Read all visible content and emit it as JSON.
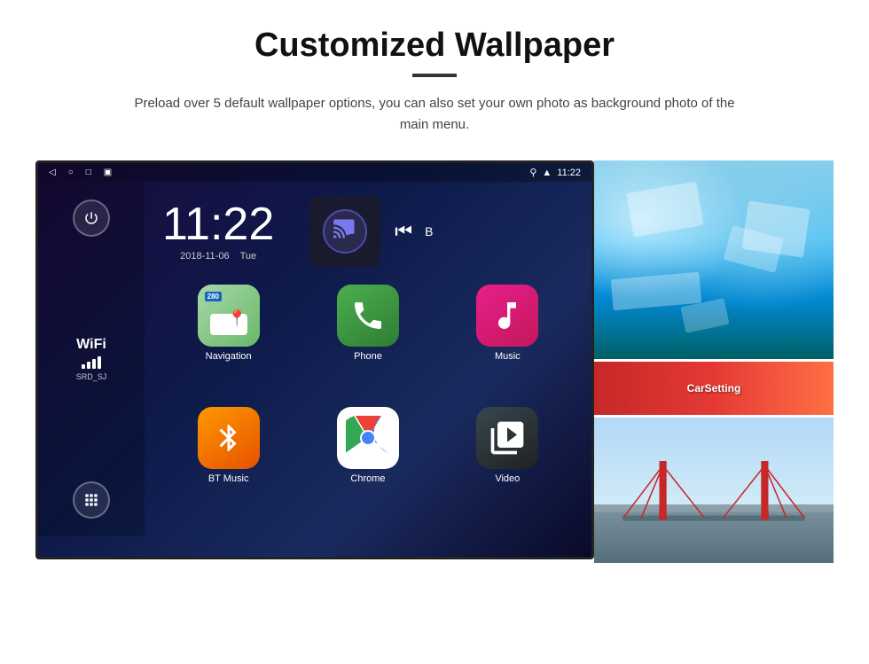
{
  "page": {
    "title": "Customized Wallpaper",
    "subtitle": "Preload over 5 default wallpaper options, you can also set your own photo as background photo of the main menu."
  },
  "status_bar": {
    "time": "11:22",
    "icons": [
      "back",
      "home",
      "recent",
      "screenshot"
    ],
    "right_icons": [
      "location",
      "wifi",
      "time"
    ]
  },
  "clock": {
    "time": "11:22",
    "date": "2018-11-06",
    "day": "Tue"
  },
  "wifi": {
    "label": "WiFi",
    "ssid": "SRD_SJ"
  },
  "apps": [
    {
      "id": "navigation",
      "label": "Navigation",
      "icon_type": "nav"
    },
    {
      "id": "phone",
      "label": "Phone",
      "icon_type": "phone"
    },
    {
      "id": "music",
      "label": "Music",
      "icon_type": "music"
    },
    {
      "id": "bt-music",
      "label": "BT Music",
      "icon_type": "bt"
    },
    {
      "id": "chrome",
      "label": "Chrome",
      "icon_type": "chrome"
    },
    {
      "id": "video",
      "label": "Video",
      "icon_type": "video"
    }
  ],
  "nav_badge": "280",
  "carsetting_label": "CarSetting"
}
